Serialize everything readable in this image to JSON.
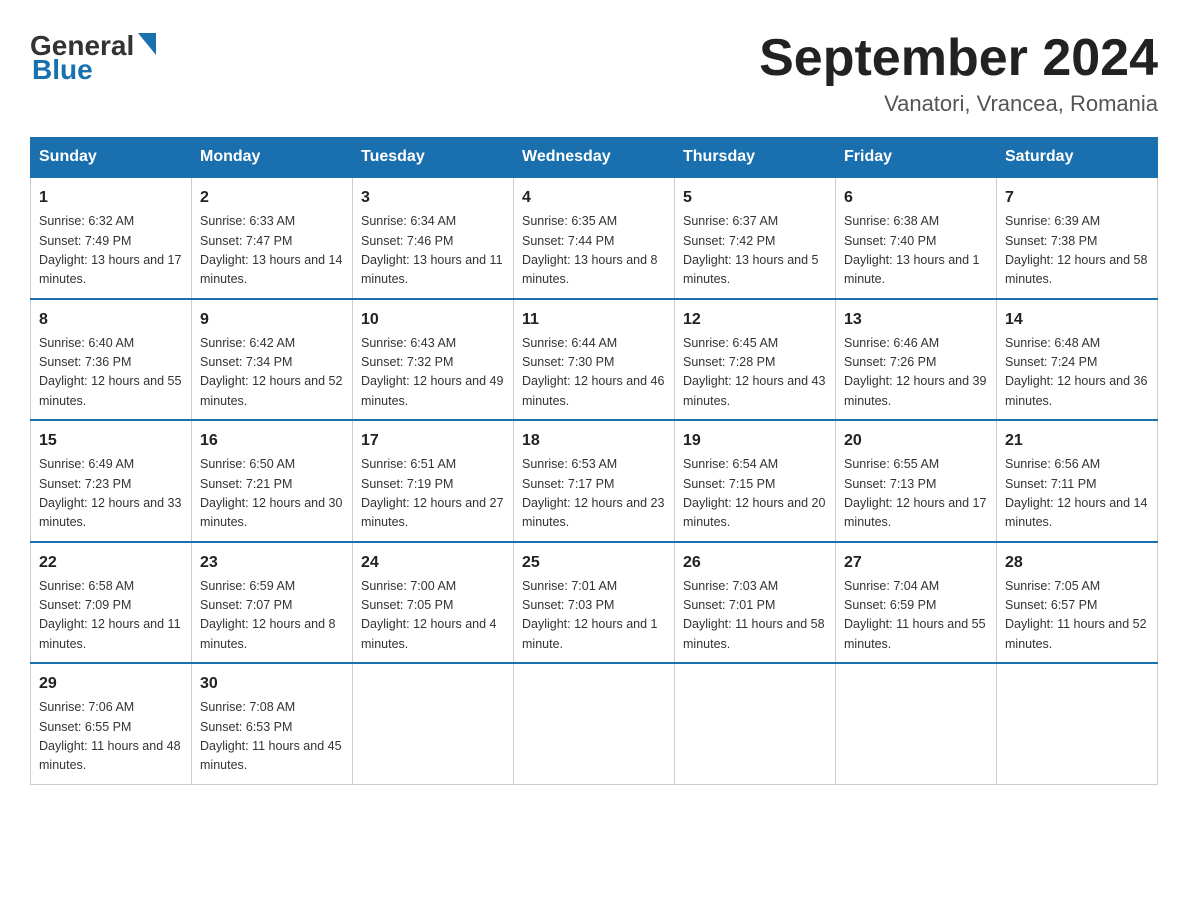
{
  "logo": {
    "line1": "General",
    "arrow": true,
    "line2": "Blue"
  },
  "title": "September 2024",
  "location": "Vanatori, Vrancea, Romania",
  "days_header": [
    "Sunday",
    "Monday",
    "Tuesday",
    "Wednesday",
    "Thursday",
    "Friday",
    "Saturday"
  ],
  "weeks": [
    [
      {
        "num": "1",
        "sunrise": "6:32 AM",
        "sunset": "7:49 PM",
        "daylight": "13 hours and 17 minutes."
      },
      {
        "num": "2",
        "sunrise": "6:33 AM",
        "sunset": "7:47 PM",
        "daylight": "13 hours and 14 minutes."
      },
      {
        "num": "3",
        "sunrise": "6:34 AM",
        "sunset": "7:46 PM",
        "daylight": "13 hours and 11 minutes."
      },
      {
        "num": "4",
        "sunrise": "6:35 AM",
        "sunset": "7:44 PM",
        "daylight": "13 hours and 8 minutes."
      },
      {
        "num": "5",
        "sunrise": "6:37 AM",
        "sunset": "7:42 PM",
        "daylight": "13 hours and 5 minutes."
      },
      {
        "num": "6",
        "sunrise": "6:38 AM",
        "sunset": "7:40 PM",
        "daylight": "13 hours and 1 minute."
      },
      {
        "num": "7",
        "sunrise": "6:39 AM",
        "sunset": "7:38 PM",
        "daylight": "12 hours and 58 minutes."
      }
    ],
    [
      {
        "num": "8",
        "sunrise": "6:40 AM",
        "sunset": "7:36 PM",
        "daylight": "12 hours and 55 minutes."
      },
      {
        "num": "9",
        "sunrise": "6:42 AM",
        "sunset": "7:34 PM",
        "daylight": "12 hours and 52 minutes."
      },
      {
        "num": "10",
        "sunrise": "6:43 AM",
        "sunset": "7:32 PM",
        "daylight": "12 hours and 49 minutes."
      },
      {
        "num": "11",
        "sunrise": "6:44 AM",
        "sunset": "7:30 PM",
        "daylight": "12 hours and 46 minutes."
      },
      {
        "num": "12",
        "sunrise": "6:45 AM",
        "sunset": "7:28 PM",
        "daylight": "12 hours and 43 minutes."
      },
      {
        "num": "13",
        "sunrise": "6:46 AM",
        "sunset": "7:26 PM",
        "daylight": "12 hours and 39 minutes."
      },
      {
        "num": "14",
        "sunrise": "6:48 AM",
        "sunset": "7:24 PM",
        "daylight": "12 hours and 36 minutes."
      }
    ],
    [
      {
        "num": "15",
        "sunrise": "6:49 AM",
        "sunset": "7:23 PM",
        "daylight": "12 hours and 33 minutes."
      },
      {
        "num": "16",
        "sunrise": "6:50 AM",
        "sunset": "7:21 PM",
        "daylight": "12 hours and 30 minutes."
      },
      {
        "num": "17",
        "sunrise": "6:51 AM",
        "sunset": "7:19 PM",
        "daylight": "12 hours and 27 minutes."
      },
      {
        "num": "18",
        "sunrise": "6:53 AM",
        "sunset": "7:17 PM",
        "daylight": "12 hours and 23 minutes."
      },
      {
        "num": "19",
        "sunrise": "6:54 AM",
        "sunset": "7:15 PM",
        "daylight": "12 hours and 20 minutes."
      },
      {
        "num": "20",
        "sunrise": "6:55 AM",
        "sunset": "7:13 PM",
        "daylight": "12 hours and 17 minutes."
      },
      {
        "num": "21",
        "sunrise": "6:56 AM",
        "sunset": "7:11 PM",
        "daylight": "12 hours and 14 minutes."
      }
    ],
    [
      {
        "num": "22",
        "sunrise": "6:58 AM",
        "sunset": "7:09 PM",
        "daylight": "12 hours and 11 minutes."
      },
      {
        "num": "23",
        "sunrise": "6:59 AM",
        "sunset": "7:07 PM",
        "daylight": "12 hours and 8 minutes."
      },
      {
        "num": "24",
        "sunrise": "7:00 AM",
        "sunset": "7:05 PM",
        "daylight": "12 hours and 4 minutes."
      },
      {
        "num": "25",
        "sunrise": "7:01 AM",
        "sunset": "7:03 PM",
        "daylight": "12 hours and 1 minute."
      },
      {
        "num": "26",
        "sunrise": "7:03 AM",
        "sunset": "7:01 PM",
        "daylight": "11 hours and 58 minutes."
      },
      {
        "num": "27",
        "sunrise": "7:04 AM",
        "sunset": "6:59 PM",
        "daylight": "11 hours and 55 minutes."
      },
      {
        "num": "28",
        "sunrise": "7:05 AM",
        "sunset": "6:57 PM",
        "daylight": "11 hours and 52 minutes."
      }
    ],
    [
      {
        "num": "29",
        "sunrise": "7:06 AM",
        "sunset": "6:55 PM",
        "daylight": "11 hours and 48 minutes."
      },
      {
        "num": "30",
        "sunrise": "7:08 AM",
        "sunset": "6:53 PM",
        "daylight": "11 hours and 45 minutes."
      },
      null,
      null,
      null,
      null,
      null
    ]
  ]
}
